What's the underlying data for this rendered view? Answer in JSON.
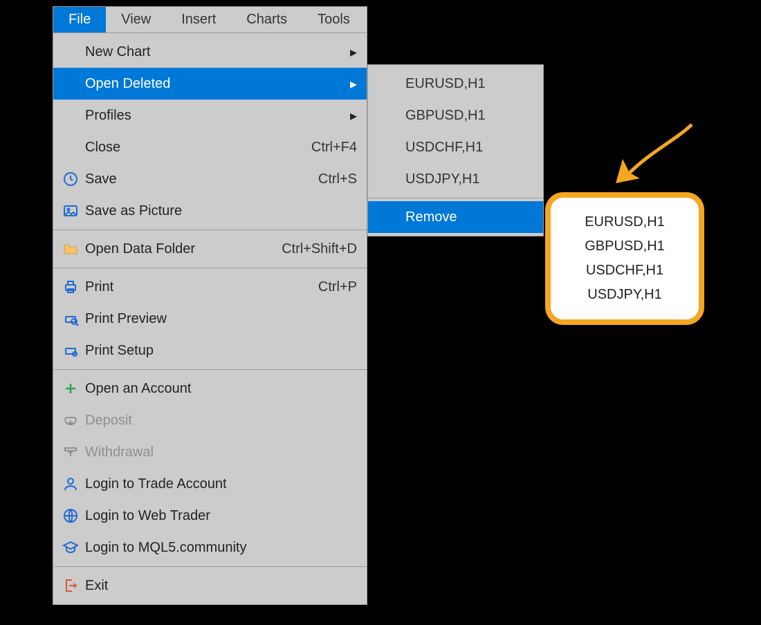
{
  "menubar": {
    "items": [
      {
        "label": "File",
        "active": true
      },
      {
        "label": "View",
        "active": false
      },
      {
        "label": "Insert",
        "active": false
      },
      {
        "label": "Charts",
        "active": false
      },
      {
        "label": "Tools",
        "active": false
      }
    ]
  },
  "file_menu": {
    "items": [
      {
        "key": "new-chart",
        "label": "New Chart",
        "submenu": true
      },
      {
        "key": "open-deleted",
        "label": "Open Deleted",
        "submenu": true,
        "selected": true
      },
      {
        "key": "profiles",
        "label": "Profiles",
        "submenu": true
      },
      {
        "key": "close",
        "label": "Close",
        "shortcut": "Ctrl+F4"
      },
      {
        "key": "save",
        "label": "Save",
        "shortcut": "Ctrl+S",
        "icon": "save-icon"
      },
      {
        "key": "save-as-picture",
        "label": "Save as Picture",
        "icon": "picture-icon"
      },
      {
        "sep": true
      },
      {
        "key": "open-data-folder",
        "label": "Open Data Folder",
        "shortcut": "Ctrl+Shift+D",
        "icon": "folder-icon"
      },
      {
        "sep": true
      },
      {
        "key": "print",
        "label": "Print",
        "shortcut": "Ctrl+P",
        "icon": "print-icon"
      },
      {
        "key": "print-preview",
        "label": "Print Preview",
        "icon": "print-preview-icon"
      },
      {
        "key": "print-setup",
        "label": "Print Setup",
        "icon": "print-setup-icon"
      },
      {
        "sep": true
      },
      {
        "key": "open-account",
        "label": "Open an Account",
        "icon": "plus-icon"
      },
      {
        "key": "deposit",
        "label": "Deposit",
        "icon": "deposit-icon",
        "disabled": true
      },
      {
        "key": "withdrawal",
        "label": "Withdrawal",
        "icon": "withdrawal-icon",
        "disabled": true
      },
      {
        "key": "login-trade",
        "label": "Login to Trade Account",
        "icon": "person-icon"
      },
      {
        "key": "login-web",
        "label": "Login to Web Trader",
        "icon": "globe-icon"
      },
      {
        "key": "login-mql5",
        "label": "Login to MQL5.community",
        "icon": "graduation-icon"
      },
      {
        "sep": true
      },
      {
        "key": "exit",
        "label": "Exit",
        "icon": "exit-icon"
      }
    ]
  },
  "submenu_open_deleted": {
    "items": [
      {
        "label": "EURUSD,H1"
      },
      {
        "label": "GBPUSD,H1"
      },
      {
        "label": "USDCHF,H1"
      },
      {
        "label": "USDJPY,H1"
      }
    ],
    "remove_label": "Remove"
  },
  "callout": {
    "items": [
      {
        "label": "EURUSD,H1"
      },
      {
        "label": "GBPUSD,H1"
      },
      {
        "label": "USDCHF,H1"
      },
      {
        "label": "USDJPY,H1"
      }
    ]
  }
}
